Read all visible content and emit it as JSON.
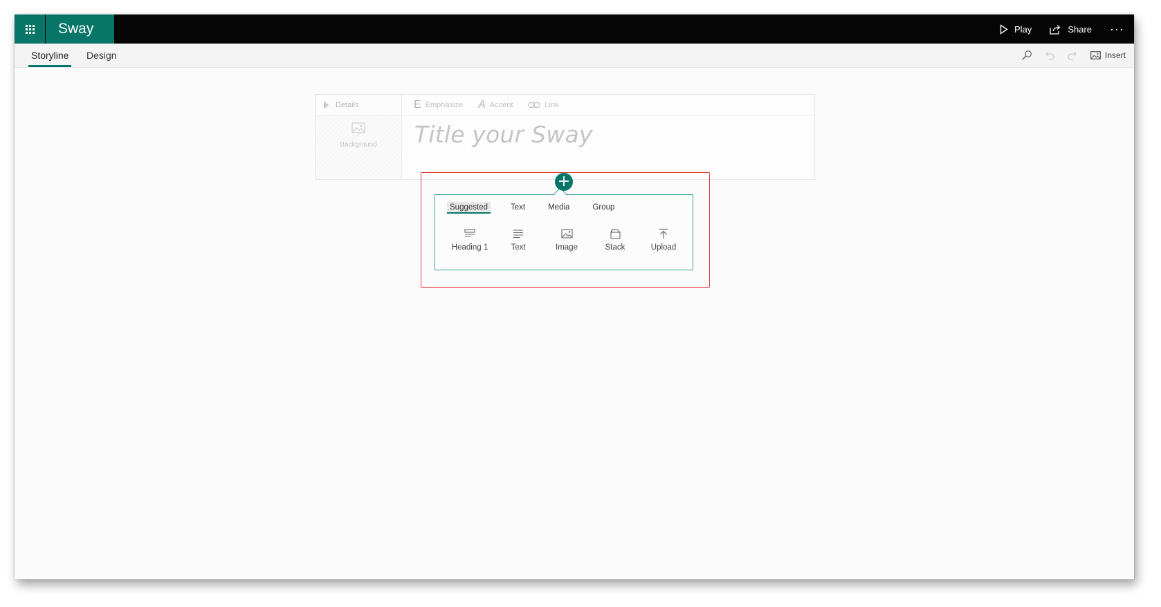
{
  "app": {
    "name": "Sway"
  },
  "top_actions": {
    "play": "Play",
    "share": "Share",
    "more": "···"
  },
  "nav": {
    "tabs": [
      {
        "label": "Storyline",
        "active": true
      },
      {
        "label": "Design",
        "active": false
      }
    ],
    "insert": "Insert"
  },
  "title_card": {
    "details": "Details",
    "background": "Background",
    "format": {
      "emphasize": "Emphasize",
      "accent": "Accent",
      "link": "Link"
    },
    "placeholder": "Title your Sway"
  },
  "insert_panel": {
    "plus": "+",
    "tabs": [
      "Suggested",
      "Text",
      "Media",
      "Group"
    ],
    "active_tab": "Suggested",
    "items": [
      {
        "label": "Heading 1",
        "icon": "heading-icon"
      },
      {
        "label": "Text",
        "icon": "text-icon"
      },
      {
        "label": "Image",
        "icon": "image-icon"
      },
      {
        "label": "Stack",
        "icon": "stack-icon"
      },
      {
        "label": "Upload",
        "icon": "upload-icon"
      }
    ]
  },
  "colors": {
    "brand": "#077568",
    "highlight": "#e53d3d",
    "panel_border": "#3aa393"
  }
}
